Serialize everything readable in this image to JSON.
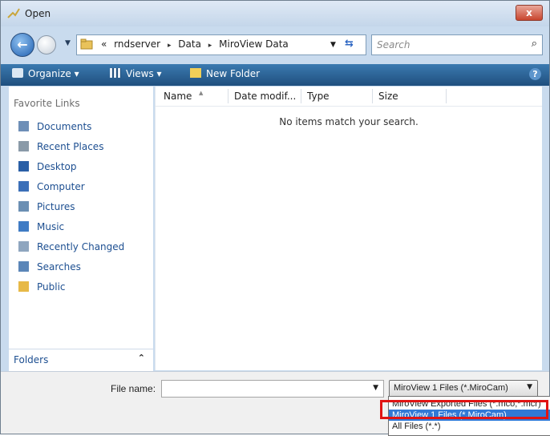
{
  "window": {
    "title": "Open",
    "close_label": "x"
  },
  "nav": {
    "history_label": "▼",
    "address_parts": [
      "«",
      "rndserver",
      "▸",
      "Data",
      "▸",
      "MiroView Data"
    ],
    "address_dropdown": "▼",
    "search_placeholder": "Search"
  },
  "toolbar": {
    "organize": "Organize ▾",
    "views": "Views ▾",
    "new_folder": "New Folder",
    "help": "?"
  },
  "sidebar": {
    "title": "Favorite Links",
    "links": [
      {
        "label": "Documents",
        "icon": "documents-icon",
        "color": "#6e8fb7"
      },
      {
        "label": "Recent Places",
        "icon": "recent-places-icon",
        "color": "#8a9aa8"
      },
      {
        "label": "Desktop",
        "icon": "desktop-icon",
        "color": "#2a5fa6"
      },
      {
        "label": "Computer",
        "icon": "computer-icon",
        "color": "#3b6fb8"
      },
      {
        "label": "Pictures",
        "icon": "pictures-icon",
        "color": "#6b8fb3"
      },
      {
        "label": "Music",
        "icon": "music-icon",
        "color": "#3f7bc4"
      },
      {
        "label": "Recently Changed",
        "icon": "recently-changed-icon",
        "color": "#8fa6bf"
      },
      {
        "label": "Searches",
        "icon": "searches-icon",
        "color": "#5b86b8"
      },
      {
        "label": "Public",
        "icon": "public-folder-icon",
        "color": "#e7b947"
      }
    ],
    "folders_label": "Folders",
    "folders_chevron": "⌃"
  },
  "list": {
    "columns": [
      "Name",
      "Date modif...",
      "Type",
      "Size"
    ],
    "empty_message": "No items match your search."
  },
  "bottom": {
    "file_name_label": "File name:",
    "file_name_value": "",
    "file_type_selected": "MiroView 1 Files (*.MiroCam)",
    "file_type_options": [
      "MiroView Exported Files (*.mco;*.mcr)",
      "MiroView 1 Files (*.MiroCam)",
      "All Files (*.*)"
    ]
  },
  "colors": {
    "toolbar": "#1f4f7e",
    "selection": "#3179d6",
    "highlight": "#e01414"
  }
}
